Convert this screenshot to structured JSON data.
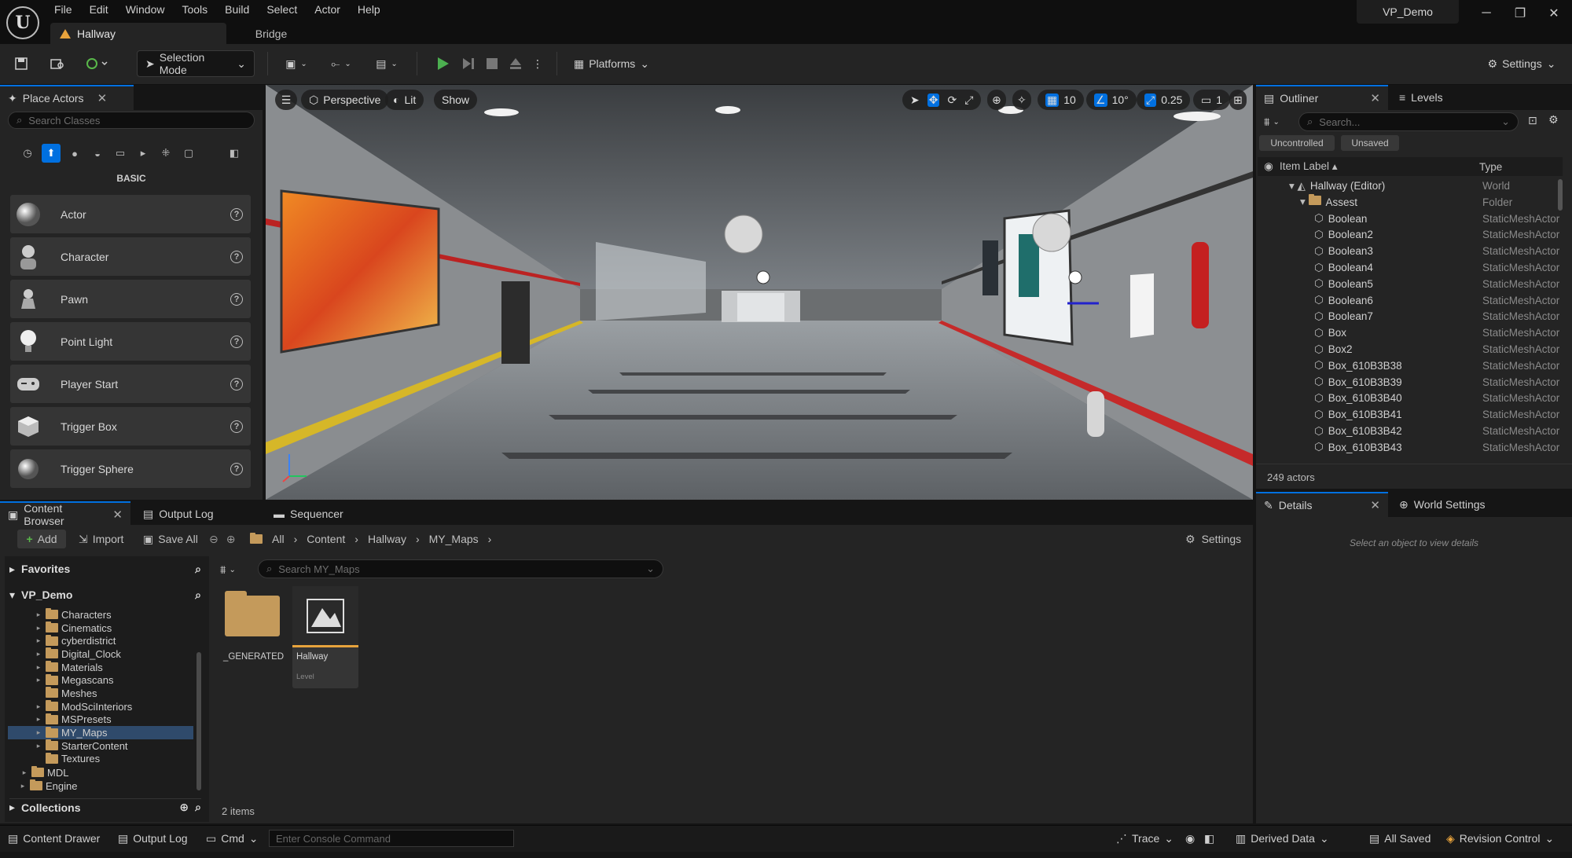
{
  "menu": [
    "File",
    "Edit",
    "Window",
    "Tools",
    "Build",
    "Select",
    "Actor",
    "Help"
  ],
  "tabs": {
    "level": "Hallway",
    "bridge": "Bridge"
  },
  "project": "VP_Demo",
  "toolbar": {
    "selection_mode": "Selection Mode",
    "platforms": "Platforms",
    "settings": "Settings"
  },
  "place_actors": {
    "title": "Place Actors",
    "search_placeholder": "Search Classes",
    "category": "BASIC",
    "items": [
      "Actor",
      "Character",
      "Pawn",
      "Point Light",
      "Player Start",
      "Trigger Box",
      "Trigger Sphere"
    ]
  },
  "viewport": {
    "perspective": "Perspective",
    "lit": "Lit",
    "show": "Show",
    "grid_snap": "10",
    "rot_snap": "10°",
    "scale_snap": "0.25",
    "cam_speed": "1"
  },
  "outliner": {
    "title": "Outliner",
    "levels_tab": "Levels",
    "search_placeholder": "Search...",
    "filter_uncontrolled": "Uncontrolled",
    "filter_unsaved": "Unsaved",
    "col_label": "Item Label",
    "col_type": "Type",
    "rows": [
      {
        "name": "Hallway (Editor)",
        "type": "World"
      },
      {
        "name": "Assest",
        "type": "Folder"
      },
      {
        "name": "Boolean",
        "type": "StaticMeshActor"
      },
      {
        "name": "Boolean2",
        "type": "StaticMeshActor"
      },
      {
        "name": "Boolean3",
        "type": "StaticMeshActor"
      },
      {
        "name": "Boolean4",
        "type": "StaticMeshActor"
      },
      {
        "name": "Boolean5",
        "type": "StaticMeshActor"
      },
      {
        "name": "Boolean6",
        "type": "StaticMeshActor"
      },
      {
        "name": "Boolean7",
        "type": "StaticMeshActor"
      },
      {
        "name": "Box",
        "type": "StaticMeshActor"
      },
      {
        "name": "Box2",
        "type": "StaticMeshActor"
      },
      {
        "name": "Box_610B3B38",
        "type": "StaticMeshActor"
      },
      {
        "name": "Box_610B3B39",
        "type": "StaticMeshActor"
      },
      {
        "name": "Box_610B3B40",
        "type": "StaticMeshActor"
      },
      {
        "name": "Box_610B3B41",
        "type": "StaticMeshActor"
      },
      {
        "name": "Box_610B3B42",
        "type": "StaticMeshActor"
      },
      {
        "name": "Box_610B3B43",
        "type": "StaticMeshActor"
      }
    ],
    "count": "249 actors"
  },
  "details": {
    "title": "Details",
    "world_settings": "World Settings",
    "empty_msg": "Select an object to view details"
  },
  "content_browser": {
    "title": "Content Browser",
    "output_log_tab": "Output Log",
    "sequencer_tab": "Sequencer",
    "add": "Add",
    "import": "Import",
    "save_all": "Save All",
    "breadcrumb": [
      "All",
      "Content",
      "Hallway",
      "MY_Maps"
    ],
    "settings": "Settings",
    "favorites": "Favorites",
    "root": "VP_Demo",
    "search_placeholder": "Search MY_Maps",
    "folders": [
      "Characters",
      "Cinematics",
      "cyberdistrict",
      "Digital_Clock",
      "Materials",
      "Megascans",
      "Meshes",
      "ModSciInteriors",
      "MSPresets",
      "MY_Maps",
      "StarterContent",
      "Textures"
    ],
    "mdl": "MDL",
    "engine": "Engine",
    "collections": "Collections",
    "assets": [
      {
        "name": "_GENERATED",
        "kind": "folder"
      },
      {
        "name": "Hallway",
        "sub": "Level",
        "kind": "level"
      }
    ],
    "item_count": "2 items"
  },
  "statusbar": {
    "content_drawer": "Content Drawer",
    "output_log": "Output Log",
    "cmd": "Cmd",
    "console_placeholder": "Enter Console Command",
    "trace": "Trace",
    "derived_data": "Derived Data",
    "all_saved": "All Saved",
    "revision_control": "Revision Control"
  },
  "colors": {
    "accent": "#0070e0",
    "folder": "#c49a5b",
    "play": "#4caf50",
    "level_underline": "#e8a33c"
  }
}
